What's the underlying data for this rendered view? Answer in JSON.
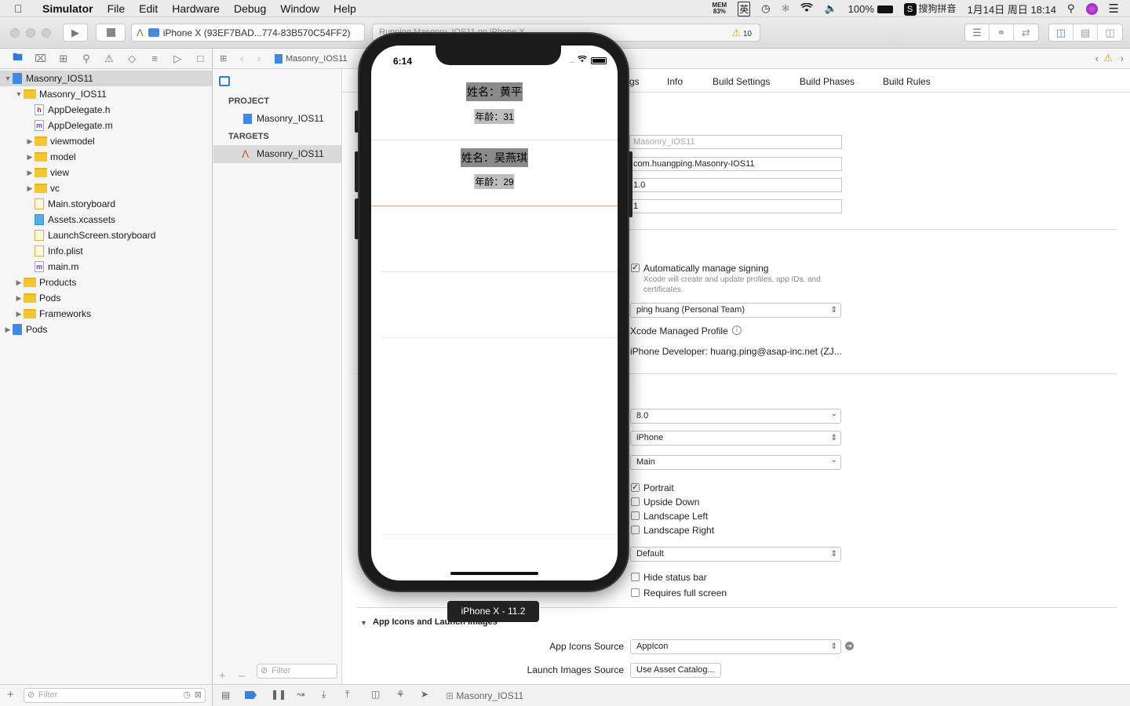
{
  "menubar": {
    "app": "Simulator",
    "items": [
      "File",
      "Edit",
      "Hardware",
      "Debug",
      "Window",
      "Help"
    ],
    "mem_top": "MEM",
    "mem_value": "83%",
    "ime_char": "英",
    "battery": "100%",
    "sogou_label": "搜狗拼音",
    "datetime": "1月14日 周日  18:14"
  },
  "toolbar": {
    "scheme_device": "iPhone X (93EF7BAD...774-83B570C54FF2)",
    "activity": "Running Masonry_IOS11 on iPhone X",
    "warnings": "10"
  },
  "navigator": {
    "filter_placeholder": "Filter",
    "tree": [
      {
        "label": "Masonry_IOS11",
        "level": 0,
        "kind": "project",
        "open": true,
        "selected": true
      },
      {
        "label": "Masonry_IOS11",
        "level": 1,
        "kind": "folder",
        "open": true
      },
      {
        "label": "AppDelegate.h",
        "level": 2,
        "kind": "h"
      },
      {
        "label": "AppDelegate.m",
        "level": 2,
        "kind": "m"
      },
      {
        "label": "viewmodel",
        "level": 2,
        "kind": "folder",
        "open": false
      },
      {
        "label": "model",
        "level": 2,
        "kind": "folder",
        "open": false
      },
      {
        "label": "view",
        "level": 2,
        "kind": "folder",
        "open": false
      },
      {
        "label": "vc",
        "level": 2,
        "kind": "folder",
        "open": false
      },
      {
        "label": "Main.storyboard",
        "level": 2,
        "kind": "sb"
      },
      {
        "label": "Assets.xcassets",
        "level": 2,
        "kind": "as"
      },
      {
        "label": "LaunchScreen.storyboard",
        "level": 2,
        "kind": "sb"
      },
      {
        "label": "Info.plist",
        "level": 2,
        "kind": "sb"
      },
      {
        "label": "main.m",
        "level": 2,
        "kind": "m"
      },
      {
        "label": "Products",
        "level": 1,
        "kind": "folder",
        "open": false
      },
      {
        "label": "Pods",
        "level": 1,
        "kind": "folder",
        "open": false
      },
      {
        "label": "Frameworks",
        "level": 1,
        "kind": "folder",
        "open": false
      },
      {
        "label": "Pods",
        "level": 0,
        "kind": "project",
        "open": false
      }
    ]
  },
  "editor": {
    "breadcrumb": "Masonry_IOS11",
    "project_header": "PROJECT",
    "project_item": "Masonry_IOS11",
    "targets_header": "TARGETS",
    "target_item": "Masonry_IOS11",
    "filter_placeholder": "Filter",
    "tabs": [
      "gs",
      "Info",
      "Build Settings",
      "Build Phases",
      "Build Rules"
    ],
    "identity": {
      "display_name_placeholder": "Masonry_IOS11",
      "bundle_id": "com.huangping.Masonry-IOS11",
      "version": "1.0",
      "build": "1"
    },
    "signing": {
      "auto_manage": "Automatically manage signing",
      "auto_manage_desc_1": "Xcode will create and update profiles, app IDs, and",
      "auto_manage_desc_2": "certificates.",
      "team": "ping huang (Personal Team)",
      "profile": "Xcode Managed Profile",
      "certificate": "iPhone Developer: huang.ping@asap-inc.net (ZJ..."
    },
    "deployment": {
      "target": "8.0",
      "devices": "iPhone",
      "main_interface": "Main",
      "orientations": [
        {
          "label": "Portrait",
          "checked": true
        },
        {
          "label": "Upside Down",
          "checked": false
        },
        {
          "label": "Landscape Left",
          "checked": false
        },
        {
          "label": "Landscape Right",
          "checked": false
        }
      ],
      "status_bar_style": "Default",
      "hide_status_bar": "Hide status bar",
      "requires_full_screen": "Requires full screen"
    },
    "app_icons": {
      "section": "App Icons and Launch Images",
      "icons_source_label": "App Icons Source",
      "icons_source_value": "AppIcon",
      "launch_source_label": "Launch Images Source",
      "launch_button": "Use Asset Catalog..."
    },
    "debug_target": "Masonry_IOS11"
  },
  "simulator": {
    "time": "6:14",
    "cells": [
      {
        "name": "姓名：黄平",
        "age": "年龄：31"
      },
      {
        "name": "姓名：吴燕琪",
        "age": "年龄：29"
      }
    ],
    "label": "iPhone X - 11.2"
  }
}
